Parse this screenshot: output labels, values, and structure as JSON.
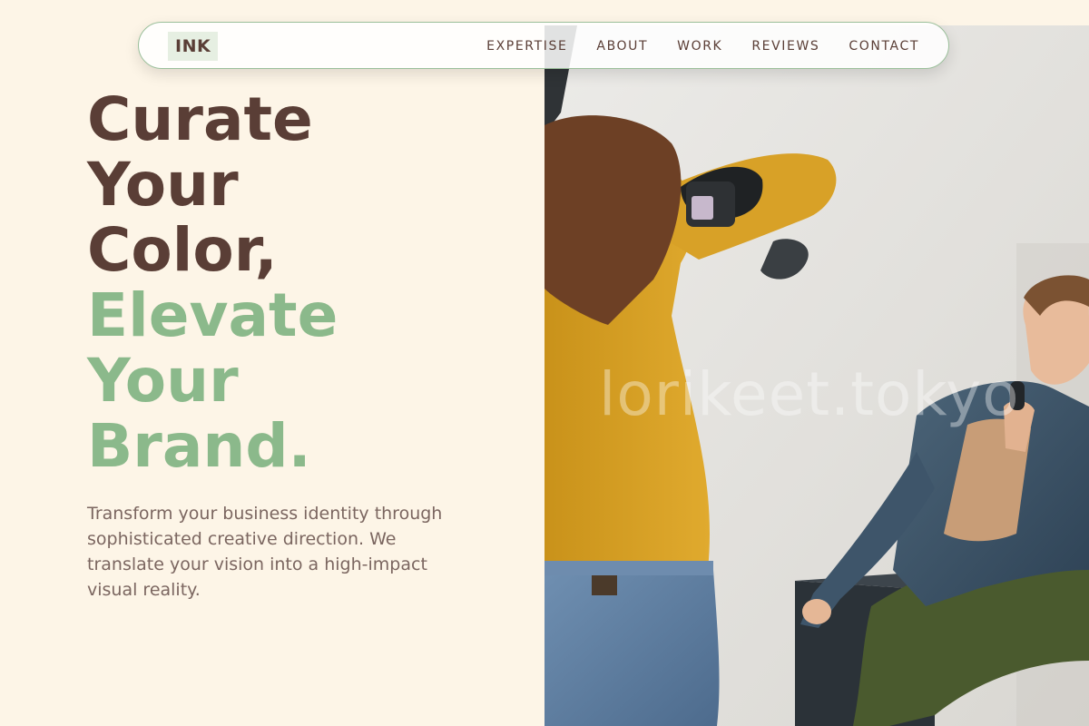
{
  "brand": {
    "logo": "INK"
  },
  "nav": {
    "items": [
      {
        "label": "EXPERTISE"
      },
      {
        "label": "ABOUT"
      },
      {
        "label": "WORK"
      },
      {
        "label": "REVIEWS"
      },
      {
        "label": "CONTACT"
      }
    ]
  },
  "hero": {
    "headline_lines_dark": [
      "Curate",
      "Your",
      "Color,"
    ],
    "headline_lines_accent": [
      "Elevate",
      "Your",
      "Brand."
    ],
    "description": "Transform your business identity through sophisticated creative direction. We translate your vision into a high-impact visual reality.",
    "watermark": "lorikeet.tokyo"
  },
  "colors": {
    "background": "#fdf5e7",
    "brown": "#5a3e36",
    "accent_green": "#8bb98b",
    "nav_border": "#9bbf9a"
  },
  "icons": {
    "hero_image": "photographer-shooting-model-photo"
  }
}
